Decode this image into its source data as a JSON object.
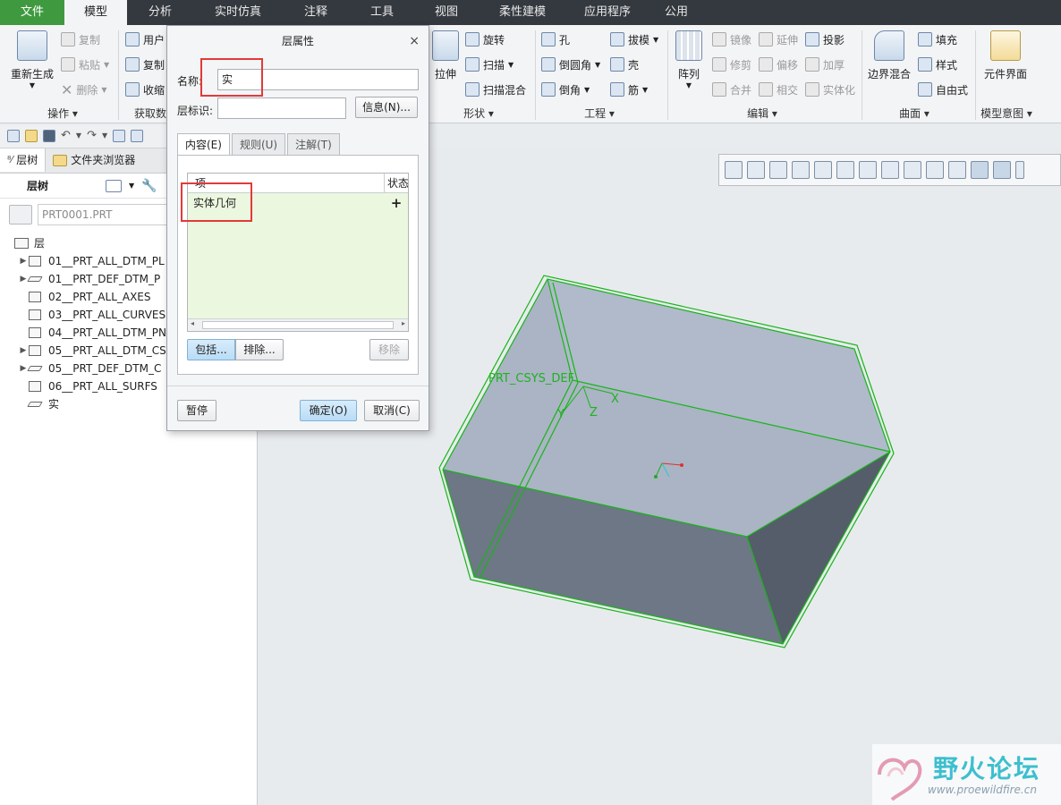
{
  "menu": {
    "tabs": [
      "文件",
      "模型",
      "分析",
      "实时仿真",
      "注释",
      "工具",
      "视图",
      "柔性建模",
      "应用程序",
      "公用"
    ],
    "active_index": 1
  },
  "ribbon": {
    "ops_group": {
      "regen": "重新生成",
      "copy": "复制",
      "paste": "粘贴",
      "delete": "删除",
      "label": "操作"
    },
    "get_group": {
      "user": "用户",
      "copy2": "复制",
      "shrink": "收缩",
      "label": "获取数"
    },
    "shape_group": {
      "extrude": "拉伸",
      "revolve": "旋转",
      "sweep": "扫描",
      "sweep_blend": "扫描混合",
      "label": "形状"
    },
    "eng_group": {
      "hole": "孔",
      "round": "倒圆角",
      "chamfer": "倒角",
      "draft": "拔模",
      "shell": "壳",
      "rib": "筋",
      "label": "工程"
    },
    "edit_group": {
      "pattern": "阵列",
      "mirror": "镜像",
      "trim": "修剪",
      "merge": "合并",
      "extend": "延伸",
      "offset": "偏移",
      "intersect": "相交",
      "project": "投影",
      "thicken": "加厚",
      "solidify": "实体化",
      "label": "编辑"
    },
    "surface_group": {
      "boundary": "边界混合",
      "fill": "填充",
      "style": "样式",
      "freestyle": "自由式",
      "label": "曲面"
    },
    "intent_group": {
      "component": "元件界面",
      "label": "模型意图"
    }
  },
  "left_panel": {
    "tab_layer_tree": "层树",
    "tab_folder": "文件夹浏览器",
    "header_label": "层树",
    "model_name": "PRT0001.PRT",
    "root_label": "层",
    "items": [
      {
        "label": "01__PRT_ALL_DTM_PL",
        "expand": "▶"
      },
      {
        "label": "01__PRT_DEF_DTM_P",
        "expand": "▶"
      },
      {
        "label": "02__PRT_ALL_AXES",
        "expand": ""
      },
      {
        "label": "03__PRT_ALL_CURVES",
        "expand": ""
      },
      {
        "label": "04__PRT_ALL_DTM_PN",
        "expand": ""
      },
      {
        "label": "05__PRT_ALL_DTM_CS",
        "expand": "▶"
      },
      {
        "label": "05__PRT_DEF_DTM_C",
        "expand": "▶"
      },
      {
        "label": "06__PRT_ALL_SURFS",
        "expand": ""
      },
      {
        "label": "实",
        "expand": ""
      }
    ]
  },
  "dialog": {
    "title": "层属性",
    "close": "×",
    "name_label": "名称:",
    "name_value": "实",
    "id_label": "层标识:",
    "id_value": "",
    "info_button": "信息(N)...",
    "tabs": [
      "内容(E)",
      "规则(U)",
      "注解(T)"
    ],
    "table": {
      "col_item": "项",
      "col_status": "状态",
      "rows": [
        {
          "item": "实体几何",
          "status": "+"
        }
      ]
    },
    "include_button": "包括...",
    "exclude_button": "排除...",
    "remove_button": "移除",
    "pause_button": "暂停",
    "ok_button": "确定(O)",
    "cancel_button": "取消(C)"
  },
  "graphics": {
    "csys_label": "PRT_CSYS_DEF",
    "axis_x": "X",
    "axis_y": "Y",
    "axis_z": "Z"
  },
  "watermark": {
    "title": "野火论坛",
    "url": "www.proewildfire.cn"
  }
}
